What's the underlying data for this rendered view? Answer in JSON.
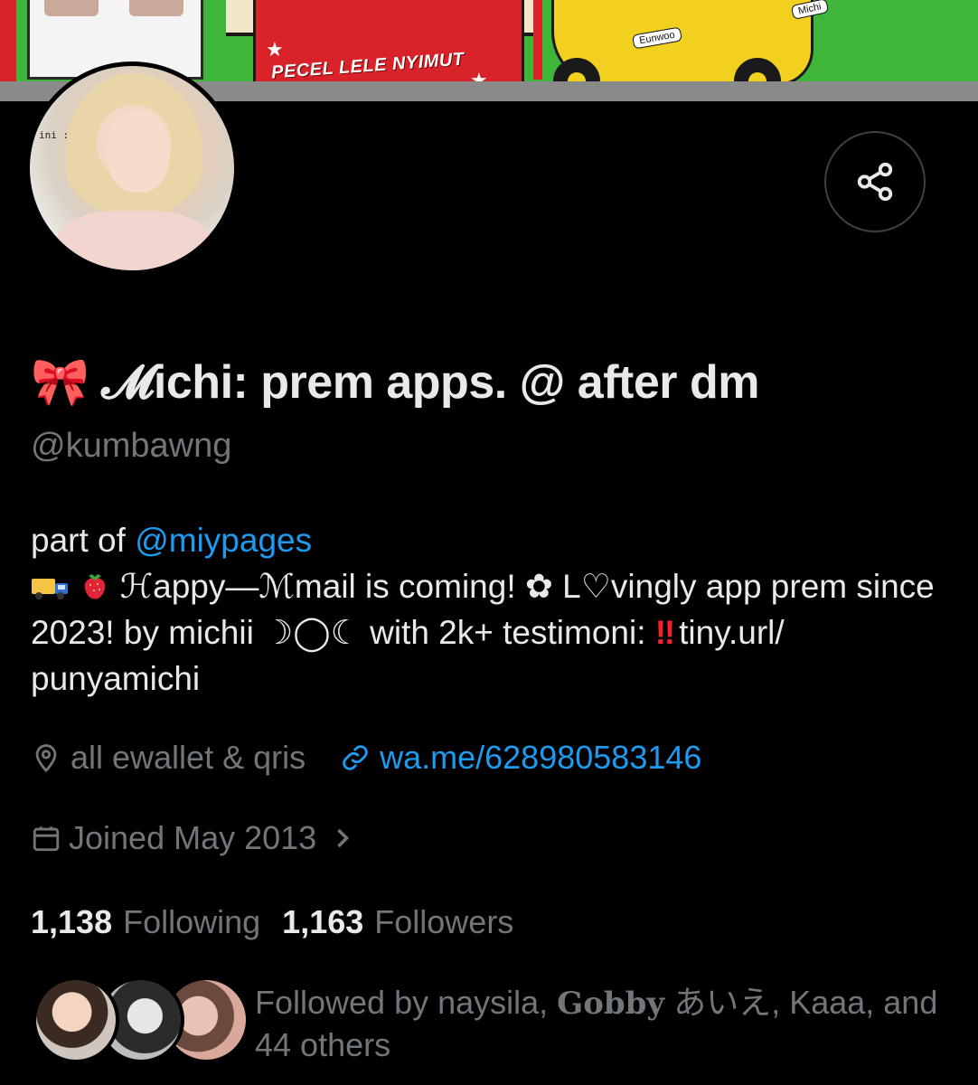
{
  "banner": {
    "cart_sign": "PECEL LELE NYIMUT",
    "sticker_1": "Eunwoo",
    "sticker_2": "Michi"
  },
  "avatar": {
    "tag": "ini :"
  },
  "profile": {
    "display_name": "🎀 𝓜ichi: prem apps. @ after dm",
    "handle": "@kumbawng"
  },
  "bio": {
    "line1_prefix": "part of ",
    "line1_mention": "@miypages",
    "line2_text": "ℋappy—ℳmail is coming! ✿ L♡vingly app prem since 2023! by michii ☽◯☾ with 2k+ testimoni: ",
    "bang": "‼",
    "line2_tail": "tiny.url/ punyamichi"
  },
  "meta": {
    "location": "all ewallet & qris",
    "link": "wa.me/628980583146",
    "joined": "Joined May 2013"
  },
  "stats": {
    "following_count": "1,138",
    "following_label": "Following",
    "followers_count": "1,163",
    "followers_label": "Followers"
  },
  "followed_by": {
    "prefix": "Followed by naysila, ",
    "name2": "Gobby",
    "name2_tail": " あいえ, Kaaa, and 44 others"
  },
  "colors": {
    "background": "#000000",
    "text_primary": "#e7e9ea",
    "text_secondary": "#71767b",
    "accent_link": "#1d9bf0",
    "border": "#3d4146"
  },
  "icons": {
    "share": "share-icon",
    "location": "location-pin-icon",
    "link": "link-icon",
    "calendar": "calendar-icon",
    "chevron": "chevron-right-icon"
  }
}
